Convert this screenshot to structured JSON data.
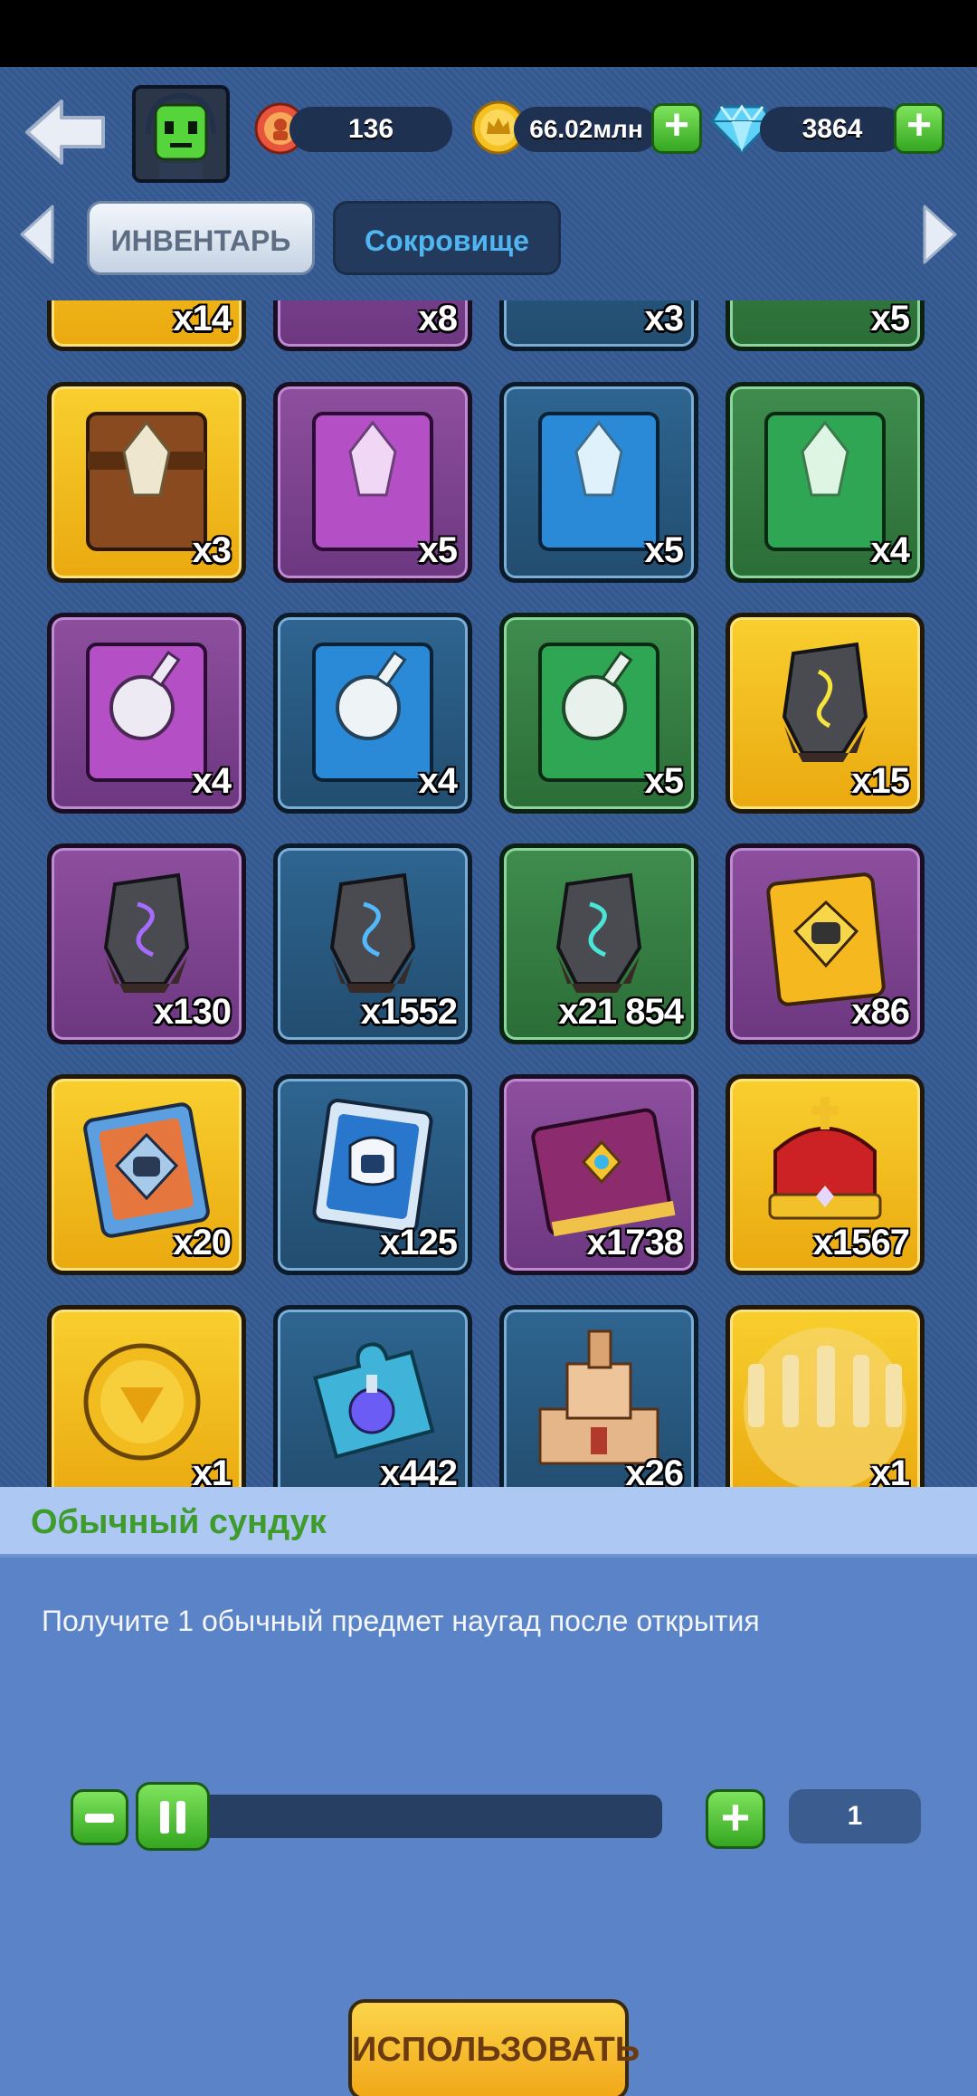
{
  "header": {
    "resources": {
      "stamina": "136",
      "gold": "66.02млн",
      "gems": "3864"
    }
  },
  "tabs": [
    {
      "label": "ИНВЕНТАРЬ",
      "active": true
    },
    {
      "label": "Сокровище",
      "active": false
    }
  ],
  "inventory": {
    "partial_row": [
      {
        "qty": "x14",
        "color": "gold"
      },
      {
        "qty": "x8",
        "color": "purple"
      },
      {
        "qty": "x3",
        "color": "blue"
      },
      {
        "qty": "x5",
        "color": "green"
      }
    ],
    "rows": [
      [
        {
          "qty": "x3",
          "color": "gold",
          "icon": "crystal-book-icon"
        },
        {
          "qty": "x5",
          "color": "purple",
          "icon": "crystal-book-icon"
        },
        {
          "qty": "x5",
          "color": "blue",
          "icon": "crystal-book-icon"
        },
        {
          "qty": "x4",
          "color": "green",
          "icon": "crystal-book-icon"
        }
      ],
      [
        {
          "qty": "x4",
          "color": "purple",
          "icon": "potion-book-icon"
        },
        {
          "qty": "x4",
          "color": "blue",
          "icon": "potion-book-icon"
        },
        {
          "qty": "x5",
          "color": "green",
          "icon": "potion-book-icon"
        },
        {
          "qty": "x15",
          "color": "gold",
          "icon": "rune-stone-icon"
        }
      ],
      [
        {
          "qty": "x130",
          "color": "purple",
          "icon": "rune-stone-icon"
        },
        {
          "qty": "x1552",
          "color": "blue",
          "icon": "rune-stone-icon"
        },
        {
          "qty": "x21 854",
          "color": "green",
          "icon": "rune-stone-icon"
        },
        {
          "qty": "x86",
          "color": "purple",
          "icon": "helmet-card-icon"
        }
      ],
      [
        {
          "qty": "x20",
          "color": "gold",
          "icon": "helmet-card-icon"
        },
        {
          "qty": "x125",
          "color": "blue",
          "icon": "helmet-card-icon"
        },
        {
          "qty": "x1738",
          "color": "purple",
          "icon": "gem-book-icon"
        },
        {
          "qty": "x1567",
          "color": "gold",
          "icon": "crown-icon"
        }
      ],
      [
        {
          "qty": "x1",
          "color": "gold",
          "icon": "medal-icon"
        },
        {
          "qty": "x442",
          "color": "blue",
          "icon": "puzzle-potion-icon"
        },
        {
          "qty": "x26",
          "color": "blue",
          "icon": "castle-icon"
        },
        {
          "qty": "x1",
          "color": "gold",
          "icon": "chess-pieces-icon"
        }
      ]
    ]
  },
  "panel": {
    "title": "Обычный сундук",
    "description": "Получите 1 обычный предмет наугад после открытия",
    "count": "1",
    "use_label": "ИСПОЛЬЗОВАТЬ"
  }
}
